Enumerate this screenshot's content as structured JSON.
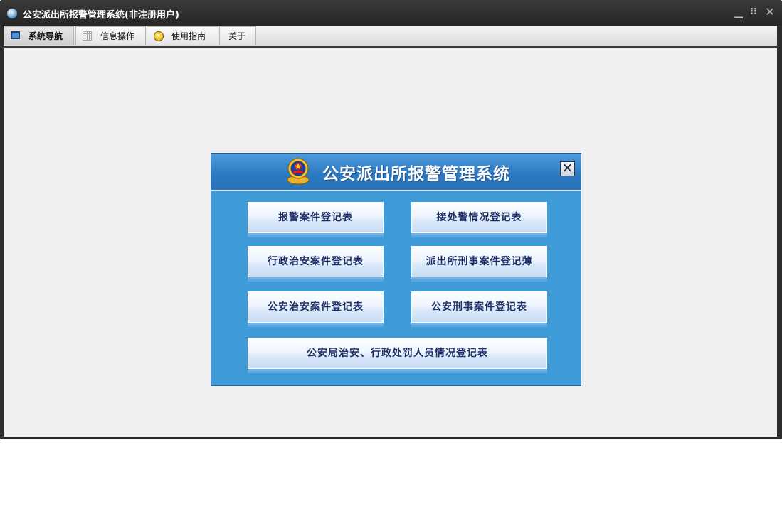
{
  "window": {
    "title": "公安派出所报警管理系统(非注册用户)",
    "controls": {
      "minimize": "▁",
      "restore": "⁝⁝",
      "close": "✕"
    }
  },
  "tabs": [
    {
      "label": "系统导航",
      "icon": "monitor-icon",
      "active": true
    },
    {
      "label": "信息操作",
      "icon": "grid-icon",
      "active": false
    },
    {
      "label": "使用指南",
      "icon": "bulb-icon",
      "active": false
    },
    {
      "label": "关于",
      "icon": "",
      "active": false
    }
  ],
  "dialog": {
    "title": "公安派出所报警管理系统",
    "close_label": "✕",
    "buttons": [
      "报警案件登记表",
      "接处警情况登记表",
      "行政治安案件登记表",
      "派出所刑事案件登记薄",
      "公安治安案件登记表",
      "公安刑事案件登记表",
      "公安局治安、行政处罚人员情况登记表"
    ]
  },
  "colors": {
    "titlebar": "#2c2c2c",
    "dialog_body": "#3e9bd8",
    "dialog_header": "#2e7bc3",
    "button_text": "#1e2f66"
  }
}
